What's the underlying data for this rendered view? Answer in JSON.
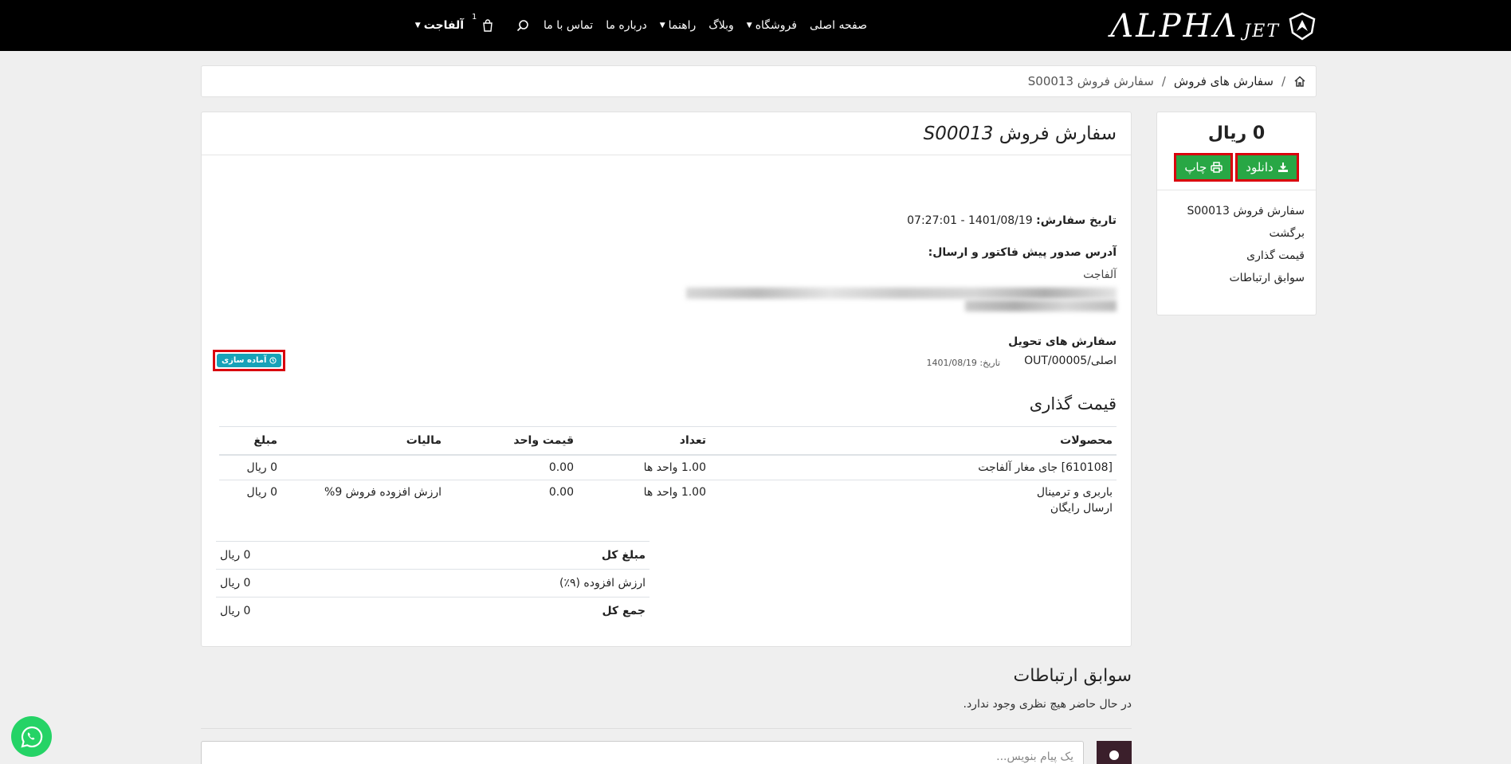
{
  "header": {
    "logo_text": "ΛLPHΛ",
    "logo_suffix": "JET",
    "nav": {
      "home": "صفحه اصلی",
      "shop": "فروشگاه",
      "blog": "وبلاگ",
      "guide": "راهنما",
      "about": "درباره ما",
      "contact": "تماس با ما",
      "cart_count": "1",
      "user": "آلفاجت"
    }
  },
  "breadcrumb": {
    "home_icon": "home-icon",
    "orders": "سفارش های فروش",
    "current": "سفارش فروش S00013"
  },
  "order": {
    "title_prefix": "سفارش فروش",
    "title_code": "S00013",
    "date_label": "تاریخ سفارش:",
    "date_value": "1401/08/19 - 07:27:01",
    "address_label": "آدرس صدور پیش فاکتور و ارسال:",
    "address_name": "آلفاجت",
    "deliveries_label": "سفارش های تحویل",
    "delivery_ref": "اصلی/OUT/00005",
    "delivery_date_label": "تاریخ:",
    "delivery_date": "1401/08/19",
    "delivery_status": "آماده سازی"
  },
  "pricing": {
    "title": "قیمت گذاری",
    "headers": {
      "products": "محصولات",
      "qty": "تعداد",
      "unit_price": "قیمت واحد",
      "taxes": "مالیات",
      "amount": "مبلغ"
    },
    "rows": [
      {
        "product": "[610108] جای مغار آلفاجت",
        "product2": "",
        "qty": "1.00 واحد ها",
        "unit_price": "0.00",
        "tax": "",
        "amount": "0 ریال"
      },
      {
        "product": "باربری و ترمینال",
        "product2": "ارسال رایگان",
        "qty": "1.00 واحد ها",
        "unit_price": "0.00",
        "tax": "ارزش افزوده فروش 9%",
        "amount": "0 ریال"
      }
    ],
    "totals": {
      "subtotal_label": "مبلغ کل",
      "subtotal_value": "0 ریال",
      "vat_label": "ارزش افزوده (۹٪)",
      "vat_value": "0 ریال",
      "total_label": "جمع کل",
      "total_value": "0 ریال"
    }
  },
  "sidebar": {
    "amount": "0 ریال",
    "download_label": "دانلود",
    "print_label": "چاپ",
    "links": [
      "سفارش فروش S00013",
      "برگشت",
      "قیمت گذاری",
      "سوابق ارتباطات"
    ]
  },
  "history": {
    "title": "سوابق ارتباطات",
    "empty": "در حال حاضر هیچ نظری وجود ندارد.",
    "placeholder": "یک پیام بنویس..."
  },
  "colors": {
    "header_bg": "#000000",
    "button_green": "#28a745",
    "badge_teal": "#17a2b8",
    "highlight_red": "#d9000d",
    "whatsapp_green": "#25d366"
  }
}
